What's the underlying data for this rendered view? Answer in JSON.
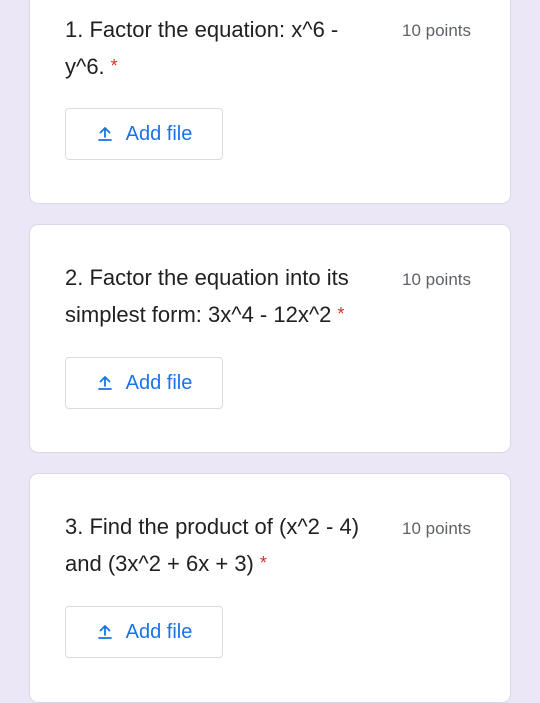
{
  "questions": [
    {
      "text": "1. Factor the equation: x^6 - y^6.",
      "required_mark": "*",
      "points": "10 points",
      "add_file_label": "Add file",
      "add_file_icon": "upload-icon"
    },
    {
      "text": "2. Factor the equation into its simplest form: 3x^4 - 12x^2",
      "required_mark": "*",
      "points": "10 points",
      "add_file_label": "Add file",
      "add_file_icon": "upload-icon"
    },
    {
      "text": "3. Find the product of (x^2 - 4) and (3x^2 + 6x + 3)",
      "required_mark": "*",
      "points": "10 points",
      "add_file_label": "Add file",
      "add_file_icon": "upload-icon"
    }
  ],
  "colors": {
    "page_background": "#ece7f6",
    "accent_blue": "#1a73e8",
    "required_red": "#d93025"
  }
}
